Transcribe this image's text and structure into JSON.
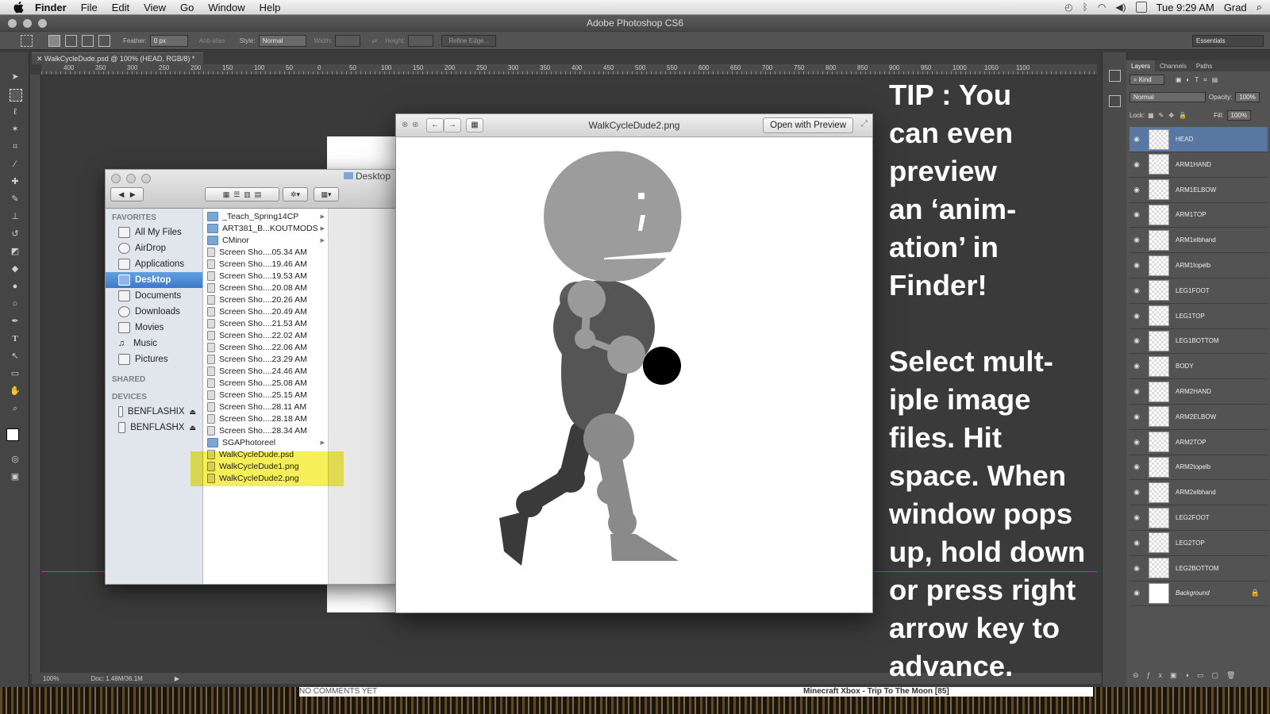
{
  "menubar": {
    "app": "Finder",
    "items": [
      "File",
      "Edit",
      "View",
      "Go",
      "Window",
      "Help"
    ],
    "clock": "Tue 9:29 AM",
    "user": "Grad"
  },
  "photoshop": {
    "window_title": "Adobe Photoshop CS6",
    "options": {
      "feather_label": "Feather:",
      "feather_value": "0 px",
      "antialias_label": "Anti-alias",
      "style_label": "Style:",
      "style_value": "Normal",
      "width_label": "Width:",
      "height_label": "Height:",
      "refine_label": "Refine Edge...",
      "workspace": "Essentials"
    },
    "doc_tab": "WalkCycleDude.psd @ 100% (HEAD, RGB/8) *",
    "ruler_ticks": [
      "400",
      "350",
      "300",
      "250",
      "200",
      "150",
      "100",
      "50",
      "0",
      "50",
      "100",
      "150",
      "200",
      "250",
      "300",
      "350",
      "400",
      "450",
      "500",
      "550",
      "600",
      "650",
      "700",
      "750",
      "800",
      "850",
      "900",
      "950",
      "1000",
      "1050",
      "1100"
    ],
    "status": {
      "zoom": "100%",
      "doc": "Doc: 1.48M/36.1M"
    }
  },
  "finder": {
    "title": "Desktop",
    "favorites_header": "FAVORITES",
    "favorites": [
      "All My Files",
      "AirDrop",
      "Applications",
      "Desktop",
      "Documents",
      "Downloads",
      "Movies",
      "Music",
      "Pictures"
    ],
    "selected_favorite": "Desktop",
    "shared_header": "SHARED",
    "devices_header": "DEVICES",
    "devices": [
      "BENFLASHIX",
      "BENFLASHX"
    ],
    "files": [
      {
        "name": "_Teach_Spring14CP",
        "folder": true
      },
      {
        "name": "ART381_B...KOUTMODS",
        "folder": true
      },
      {
        "name": "CMinor",
        "folder": true
      },
      {
        "name": "Screen Sho....05.34 AM",
        "folder": false
      },
      {
        "name": "Screen Sho....19.46 AM",
        "folder": false
      },
      {
        "name": "Screen Sho....19.53 AM",
        "folder": false
      },
      {
        "name": "Screen Sho....20.08 AM",
        "folder": false
      },
      {
        "name": "Screen Sho....20.26 AM",
        "folder": false
      },
      {
        "name": "Screen Sho....20.49 AM",
        "folder": false
      },
      {
        "name": "Screen Sho....21.53 AM",
        "folder": false
      },
      {
        "name": "Screen Sho....22.02 AM",
        "folder": false
      },
      {
        "name": "Screen Sho....22.06 AM",
        "folder": false
      },
      {
        "name": "Screen Sho....23.29 AM",
        "folder": false
      },
      {
        "name": "Screen Sho....24.46 AM",
        "folder": false
      },
      {
        "name": "Screen Sho....25.08 AM",
        "folder": false
      },
      {
        "name": "Screen Sho....25.15 AM",
        "folder": false
      },
      {
        "name": "Screen Sho....28.11 AM",
        "folder": false
      },
      {
        "name": "Screen Sho....28.18 AM",
        "folder": false
      },
      {
        "name": "Screen Sho....28.34 AM",
        "folder": false
      },
      {
        "name": "SGAPhotoreel",
        "folder": true
      },
      {
        "name": "WalkCycleDude.psd",
        "folder": false
      },
      {
        "name": "WalkCycleDude1.png",
        "folder": false,
        "highlighted": true
      },
      {
        "name": "WalkCycleDude2.png",
        "folder": false,
        "highlighted": true
      }
    ]
  },
  "quicklook": {
    "title": "WalkCycleDude2.png",
    "open_button": "Open with Preview"
  },
  "tip": {
    "lines1": [
      "TIP : You",
      "can even",
      "preview",
      "an ‘anim-",
      "ation’ in",
      "Finder!"
    ],
    "lines2": [
      "Select mult-",
      "iple image",
      "files. Hit",
      "space. When",
      "window pops",
      "up, hold down",
      "or press right",
      "arrow key to",
      "advance."
    ]
  },
  "layers_panel": {
    "tabs": [
      "Layers",
      "Channels",
      "Paths"
    ],
    "active_tab": "Layers",
    "kind_label": "Kind",
    "blend_mode": "Normal",
    "opacity_label": "Opacity:",
    "opacity_value": "100%",
    "lock_label": "Lock:",
    "fill_label": "Fill:",
    "fill_value": "100%",
    "layers": [
      "HEAD",
      "ARM1HAND",
      "ARM1ELBOW",
      "ARM1TOP",
      "ARM1elbhand",
      "ARM1topelb",
      "LEG1FOOT",
      "LEG1TOP",
      "LEG1BOTTOM",
      "BODY",
      "ARM2HAND",
      "ARM2ELBOW",
      "ARM2TOP",
      "ARM2topelb",
      "ARM2elbhand",
      "LEG2FOOT",
      "LEG2TOP",
      "LEG2BOTTOM",
      "Background"
    ],
    "selected_layer": "HEAD"
  },
  "bottom_strip": {
    "comments": "NO COMMENTS YET",
    "video": "Minecraft Xbox - Trip To The Moon [85]"
  },
  "colors": {
    "ps_bg": "#3b3b3b",
    "layer_selected": "#5877a3",
    "finder_selected": "#3c78c9",
    "highlight": "#f4ee3c",
    "tip_text": "#ffffff"
  }
}
